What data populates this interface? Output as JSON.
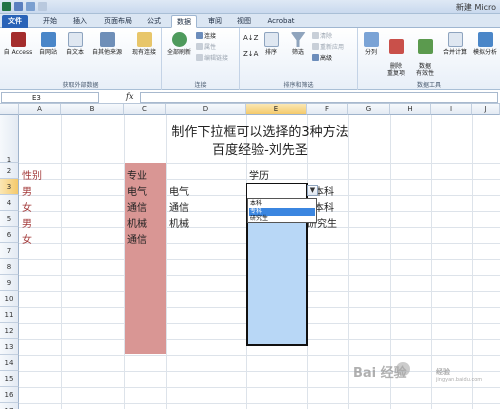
{
  "window": {
    "title": "新建 Micro"
  },
  "tabs": [
    {
      "label": "文件"
    },
    {
      "label": "开始"
    },
    {
      "label": "插入"
    },
    {
      "label": "页面布局"
    },
    {
      "label": "公式"
    },
    {
      "label": "数据"
    },
    {
      "label": "审阅"
    },
    {
      "label": "视图"
    },
    {
      "label": "Acrobat"
    }
  ],
  "ribbon": {
    "external_group": {
      "title": "获取外部数据",
      "access": "自 Access",
      "web": "自网站",
      "text": "自文本",
      "other": "自其他来源",
      "existing": "现有连接"
    },
    "connections_group": {
      "title": "连接",
      "refresh_all": "全部刷新",
      "connections": "连接",
      "properties": "属性",
      "edit_links": "编辑链接"
    },
    "sort_group": {
      "title": "排序和筛选",
      "sort": "排序",
      "filter": "筛选",
      "clear": "清除",
      "reapply": "重新应用",
      "advanced": "高级"
    },
    "tools_group": {
      "title": "数据工具",
      "split": "分列",
      "remove_dup": "删除\n重复项",
      "validation": "数据\n有效性",
      "consolidate": "合并计算",
      "whatif": "模拟分析"
    }
  },
  "formula_bar": {
    "name_box": "E3",
    "fx": "fx",
    "formula": ""
  },
  "columns": [
    "A",
    "B",
    "C",
    "D",
    "E",
    "F",
    "G",
    "H",
    "I",
    "J"
  ],
  "rows": [
    "1",
    "2",
    "3",
    "4",
    "5",
    "6",
    "7",
    "8",
    "9",
    "10",
    "11",
    "12",
    "13",
    "14",
    "15",
    "16",
    "17"
  ],
  "sheet": {
    "title_line1": "制作下拉框可以选择的3种方法",
    "title_line2": "百度经验-刘先圣",
    "col_a": [
      "性别",
      "男",
      "女",
      "男",
      "女"
    ],
    "col_c": [
      "专业",
      "电气",
      "通信",
      "机械",
      "通信"
    ],
    "col_d": [
      "电气",
      "通信",
      "机械"
    ],
    "col_e_header": "学历",
    "col_f": [
      "本科",
      "本科",
      "研究生"
    ]
  },
  "dropdown": {
    "options": [
      "本科",
      "专科",
      "研究生"
    ],
    "highlighted": 1
  },
  "colors": {
    "pink": "#d99694",
    "blue": "#b8d7f6",
    "red_text": "#a33a3a"
  },
  "watermark": {
    "brand": "Bai 经验",
    "sub": "经验",
    "url": "jingyan.baidu.com"
  }
}
